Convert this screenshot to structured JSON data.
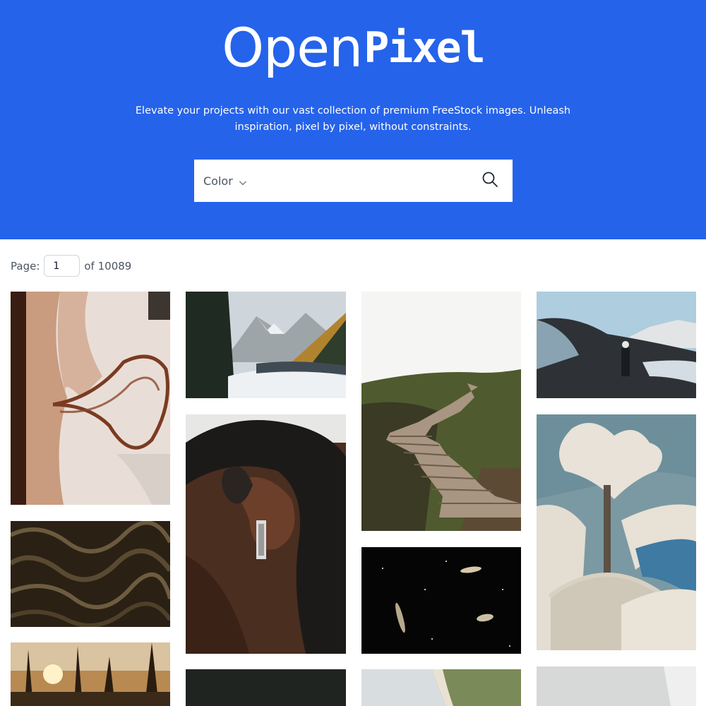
{
  "brand": {
    "name_part1": "Open",
    "name_part2": "Pixel"
  },
  "hero": {
    "tagline_line1": "Elevate your projects with our vast collection of premium FreeStock images. Unleash",
    "tagline_line2": "inspiration, pixel by pixel, without constraints.",
    "background_color": "#2563eb"
  },
  "search": {
    "filter_label": "Color",
    "filter_icon": "chevron-down-icon",
    "search_icon": "search-icon"
  },
  "pagination": {
    "label": "Page:",
    "current_page": "1",
    "total_label": "of 10089"
  },
  "gallery": {
    "images": [
      {
        "id": "aerial-shoreline",
        "subject": "aerial sand and water"
      },
      {
        "id": "snowy-mountain-lake",
        "subject": "snowy mountains and lake"
      },
      {
        "id": "hillside-stairs",
        "subject": "wooden stairs on green hillside"
      },
      {
        "id": "glacier-hiker",
        "subject": "person at glacier"
      },
      {
        "id": "ear-earring",
        "subject": "ear with earring"
      },
      {
        "id": "japanese-snow-print",
        "subject": "snowy japanese woodblock bridge"
      },
      {
        "id": "dark-fabric",
        "subject": "dark brown fabric folds"
      },
      {
        "id": "night-galaxies",
        "subject": "galaxies in night sky"
      },
      {
        "id": "sunset-trees",
        "subject": "trees at sunset"
      },
      {
        "id": "dark-panel",
        "subject": "dark image"
      },
      {
        "id": "coastline",
        "subject": "coastline from above"
      },
      {
        "id": "light-interior",
        "subject": "light grey image"
      }
    ]
  }
}
